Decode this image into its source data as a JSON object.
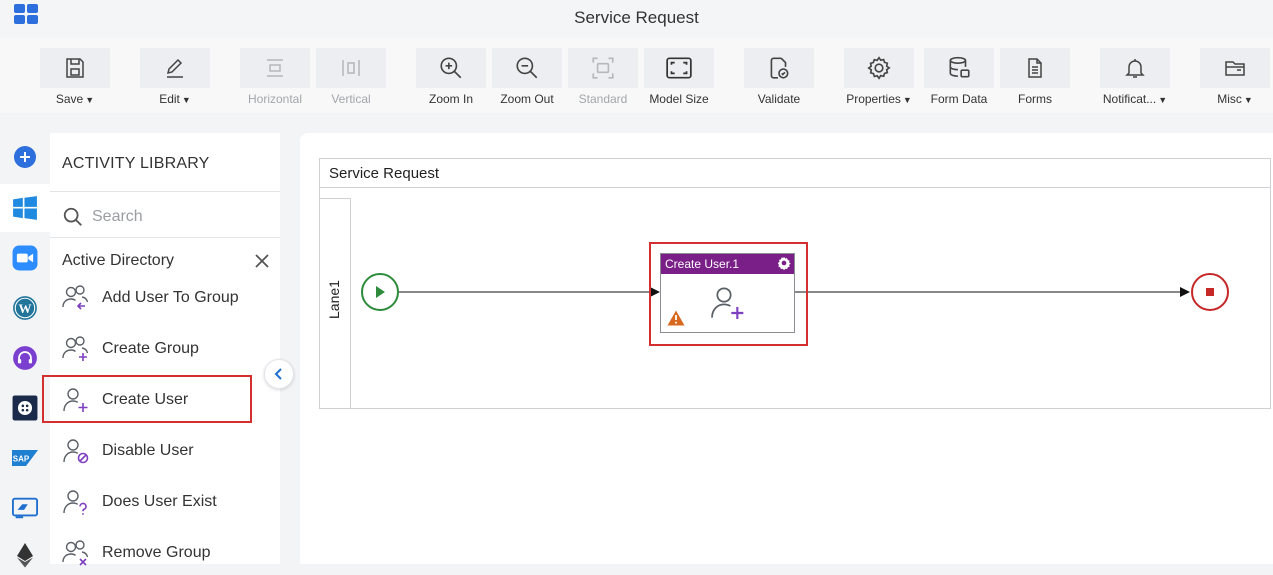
{
  "window": {
    "title": "Service Request"
  },
  "toolbar": {
    "save": "Save",
    "edit": "Edit",
    "horizontal": "Horizontal",
    "vertical": "Vertical",
    "zoom_in": "Zoom In",
    "zoom_out": "Zoom Out",
    "standard": "Standard",
    "model_size": "Model Size",
    "validate": "Validate",
    "properties": "Properties",
    "form_data": "Form Data",
    "forms": "Forms",
    "notifications": "Notificat...",
    "misc": "Misc"
  },
  "library": {
    "title": "ACTIVITY LIBRARY",
    "search_placeholder": "Search",
    "category": "Active Directory",
    "items": [
      {
        "label": "Add User To Group"
      },
      {
        "label": "Create Group"
      },
      {
        "label": "Create User",
        "selected": true
      },
      {
        "label": "Disable User"
      },
      {
        "label": "Does User Exist"
      },
      {
        "label": "Remove Group"
      }
    ]
  },
  "left_nav": {
    "icons": [
      "add-icon",
      "windows-icon",
      "zoom-icon",
      "wordpress-icon",
      "support-icon",
      "grid-app-icon",
      "sap-icon",
      "power-automate-icon",
      "ethereum-icon"
    ],
    "selected": "windows-icon"
  },
  "canvas": {
    "pool_title": "Service Request",
    "lane_label": "Lane1",
    "task": {
      "title": "Create User.1",
      "warning": true,
      "header_color": "#7a1f88"
    }
  },
  "colors": {
    "accent_blue": "#2d6fdc",
    "start_green": "#2e8b3c",
    "end_red": "#c62828",
    "highlight_red": "#d32f2f",
    "icon_purple": "#7e3ec0"
  }
}
